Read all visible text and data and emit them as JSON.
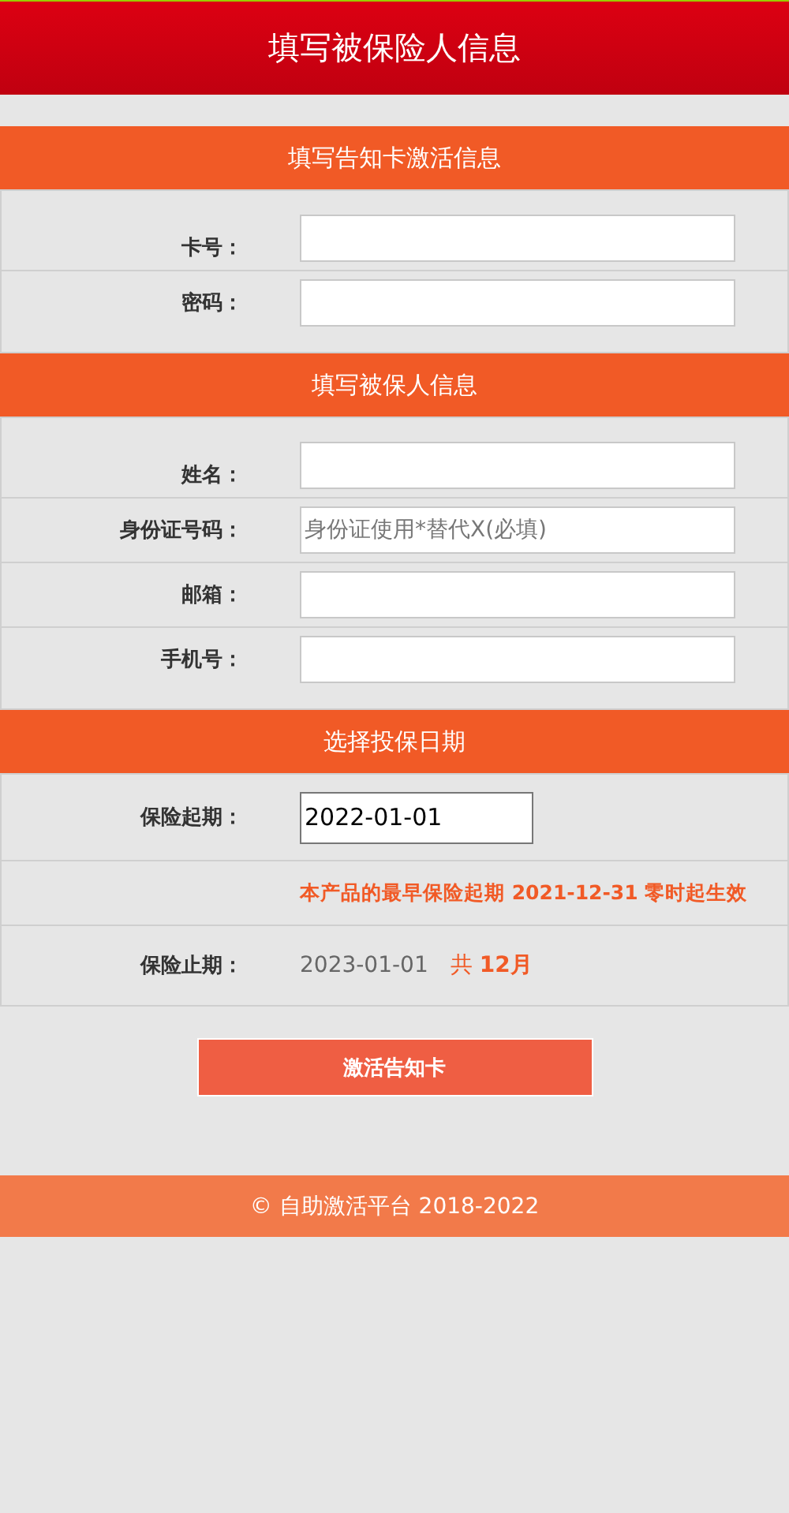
{
  "header": {
    "title": "填写被保险人信息"
  },
  "sections": [
    {
      "title": "填写告知卡激活信息",
      "rows": [
        {
          "kind": "input",
          "label": "卡号："
        },
        {
          "kind": "input",
          "label": "密码："
        }
      ]
    },
    {
      "title": "填写被保人信息",
      "rows": [
        {
          "kind": "input",
          "label": "姓名："
        },
        {
          "kind": "input",
          "label": "身份证号码：",
          "placeholder": "身份证使用*替代X(必填)"
        },
        {
          "kind": "input",
          "label": "邮箱："
        },
        {
          "kind": "input",
          "label": "手机号："
        }
      ]
    },
    {
      "title": "选择投保日期",
      "rows": [
        {
          "kind": "date",
          "label": "保险起期：",
          "value": "2022-01-01"
        },
        {
          "kind": "note",
          "text": "本产品的最早保险起期 2021-12-31 零时起生效"
        },
        {
          "kind": "text",
          "label": "保险止期：",
          "value": "2023-01-01",
          "extra": "共 **12月**"
        }
      ]
    }
  ],
  "submit": "激活告知卡",
  "footer": "©  自助激活平台 2018-2022"
}
